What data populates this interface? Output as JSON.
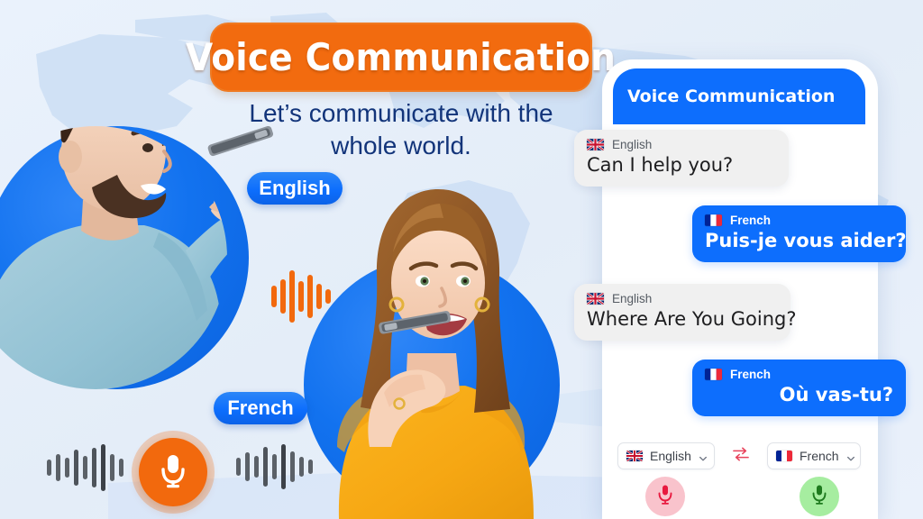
{
  "theme": {
    "accent_orange": "#F2690D",
    "accent_blue": "#0D6EFD",
    "background": "#E8F0FA",
    "heading_navy": "#12347A",
    "mic_source_bg": "#F9C3CC",
    "mic_source_fg": "#E8193F",
    "mic_target_bg": "#A6EDA0",
    "mic_target_fg": "#1E7A1E",
    "swap_icon_color": "#E8193F"
  },
  "hero": {
    "title": "Voice Communication",
    "subtitle_line1": "Let’s communicate with the",
    "subtitle_line2": "whole world.",
    "badge_english": "English",
    "badge_french": "French"
  },
  "icons": {
    "mic_main": "microphone-icon",
    "waveform_left": "waveform-icon",
    "waveform_right": "waveform-icon",
    "waveform_center": "waveform-icon",
    "swap": "swap-arrows-icon",
    "chevron": "chevron-down-icon",
    "flag_uk": "flag-uk-icon",
    "flag_fr": "flag-france-icon"
  },
  "phone": {
    "header_title": "Voice Communication",
    "messages": [
      {
        "side": "in",
        "flag": "flag-uk-icon",
        "language": "English",
        "text": "Can I help you?"
      },
      {
        "side": "out",
        "flag": "flag-france-icon",
        "language": "French",
        "text": "Puis-je vous aider?"
      },
      {
        "side": "in",
        "flag": "flag-uk-icon",
        "language": "English",
        "text": "Where Are You Going?"
      },
      {
        "side": "out",
        "flag": "flag-france-icon",
        "language": "French",
        "text": "Où vas-tu?"
      }
    ],
    "controls": {
      "source_language": "English",
      "target_language": "French",
      "source_flag": "flag-uk-icon",
      "target_flag": "flag-france-icon",
      "swap_label": "swap-arrows-icon",
      "source_mic_label": "microphone-icon",
      "target_mic_label": "microphone-icon"
    }
  }
}
